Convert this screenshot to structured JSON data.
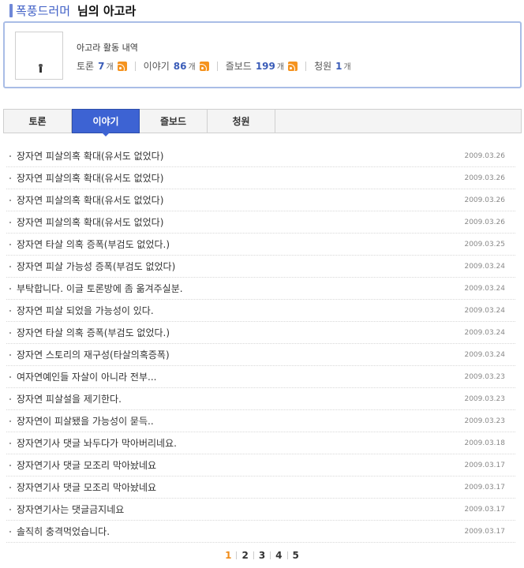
{
  "header": {
    "nickname": "폭풍드러머",
    "suffix": "님의 아고라"
  },
  "profile": {
    "activity_title": "아고라 활동 내역",
    "stats": [
      {
        "label": "토론",
        "count": "7",
        "unit": "개",
        "rss_icon": "rss-icon"
      },
      {
        "label": "이야기",
        "count": "86",
        "unit": "개",
        "rss_icon": "rss-icon"
      },
      {
        "label": "즐보드",
        "count": "199",
        "unit": "개",
        "rss_icon": "rss-icon"
      },
      {
        "label": "청원",
        "count": "1",
        "unit": "개"
      }
    ]
  },
  "tabs": [
    {
      "label": "토론",
      "active": false
    },
    {
      "label": "이야기",
      "active": true
    },
    {
      "label": "즐보드",
      "active": false
    },
    {
      "label": "청원",
      "active": false
    }
  ],
  "posts": [
    {
      "title": "장자연 피살의혹 확대(유서도 없었다)",
      "date": "2009.03.26"
    },
    {
      "title": "장자연 피살의혹 확대(유서도 없었다)",
      "date": "2009.03.26"
    },
    {
      "title": "장자연 피살의혹 확대(유서도 없었다)",
      "date": "2009.03.26"
    },
    {
      "title": "장자연 피살의혹 확대(유서도 없었다)",
      "date": "2009.03.26"
    },
    {
      "title": "장자연 타살 의혹 증폭(부검도 없었다.)",
      "date": "2009.03.25"
    },
    {
      "title": "장자연 피살 가능성 증폭(부검도 없었다)",
      "date": "2009.03.24"
    },
    {
      "title": "부탁합니다. 이글 토론방에 좀 옮겨주실분.",
      "date": "2009.03.24"
    },
    {
      "title": "장자연 피살 되었을 가능성이 있다.",
      "date": "2009.03.24"
    },
    {
      "title": "장자연 타살 의혹 증폭(부검도 없었다.)",
      "date": "2009.03.24"
    },
    {
      "title": "장자연 스토리의 재구성(타살의혹증폭)",
      "date": "2009.03.24"
    },
    {
      "title": "여자연예인들 자살이 아니라 전부...",
      "date": "2009.03.23"
    },
    {
      "title": "장자연 피살설을 제기한다.",
      "date": "2009.03.23"
    },
    {
      "title": "장자연이 피살됐을 가능성이 묻득..",
      "date": "2009.03.23"
    },
    {
      "title": "장자연기사 댓글 놔두다가 막아버리네요.",
      "date": "2009.03.18"
    },
    {
      "title": "장자연기사 댓글 모조리 막아놨네요",
      "date": "2009.03.17"
    },
    {
      "title": "장자연기사 댓글 모조리 막아놨네요",
      "date": "2009.03.17"
    },
    {
      "title": "장자연기사는 댓글금지네요",
      "date": "2009.03.17"
    },
    {
      "title": "솔직히 충격먹었습니다.",
      "date": "2009.03.17"
    }
  ],
  "pagination": {
    "pages": [
      "1",
      "2",
      "3",
      "4",
      "5"
    ],
    "current": "1"
  },
  "colors": {
    "accent_blue": "#3d63d3",
    "nickname_blue": "#3f5fc6",
    "current_page_orange": "#f08c1a",
    "rss_orange": "#f5931f"
  }
}
